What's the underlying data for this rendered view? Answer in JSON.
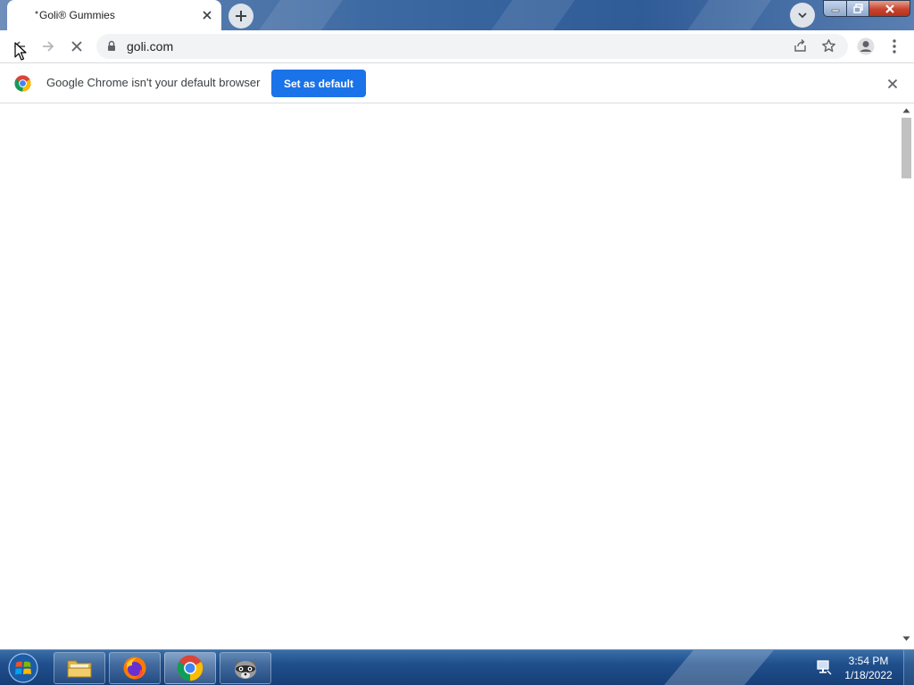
{
  "browser": {
    "tab": {
      "title": "Goli® Gummies"
    },
    "address": {
      "url": "goli.com"
    },
    "infobar": {
      "message": "Google Chrome isn't your default browser",
      "button_label": "Set as default"
    }
  },
  "taskbar": {
    "time": "3:54 PM",
    "date": "1/18/2022",
    "apps": [
      "file-explorer",
      "firefox",
      "chrome",
      "raccoon-app"
    ]
  },
  "colors": {
    "accent": "#1a73e8",
    "taskbar": "#1f4f8c"
  },
  "icons": [
    "close-icon",
    "plus-icon",
    "chevron-down-icon",
    "back-arrow-icon",
    "forward-arrow-icon",
    "stop-icon",
    "lock-icon",
    "share-icon",
    "star-icon",
    "profile-icon",
    "menu-icon",
    "chrome-logo-icon"
  ]
}
